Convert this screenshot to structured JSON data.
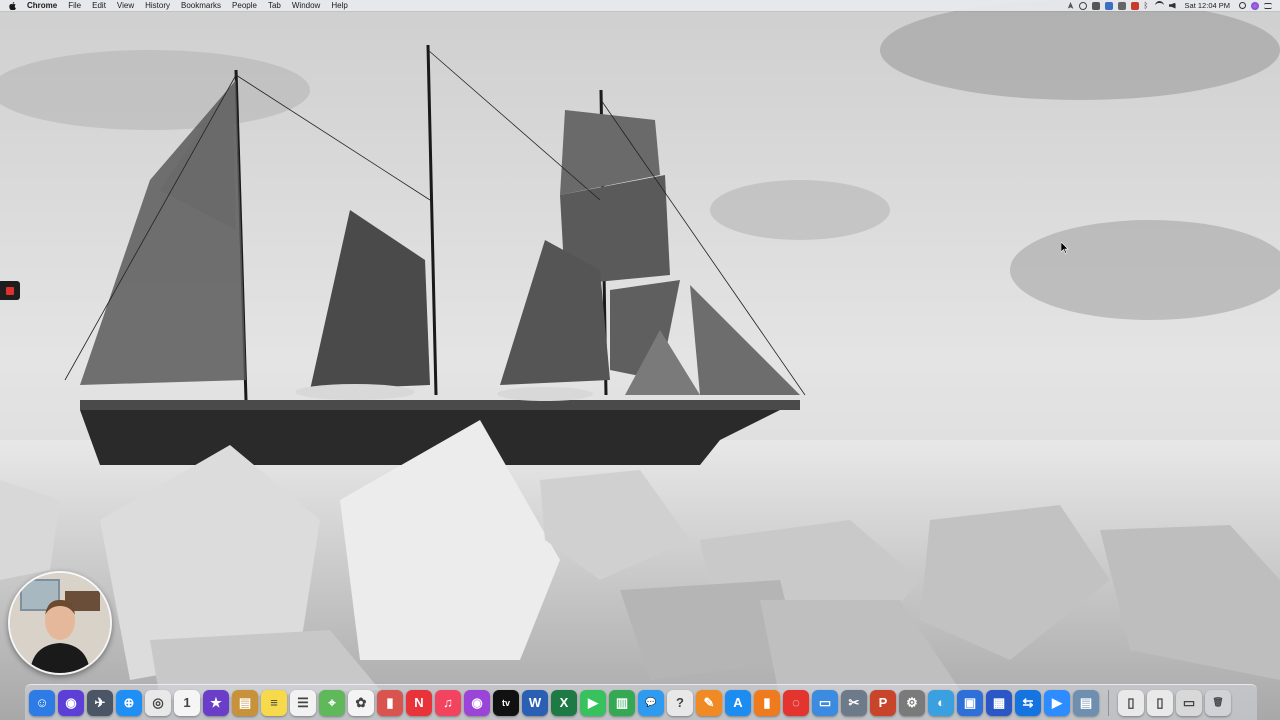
{
  "menubar": {
    "app_name": "Chrome",
    "menus": [
      "File",
      "Edit",
      "View",
      "History",
      "Bookmarks",
      "People",
      "Tab",
      "Window",
      "Help"
    ],
    "clock": "Sat 12:04 PM",
    "status_icons": [
      "location-icon",
      "screen-record-icon",
      "adobe-icon",
      "dropbox-icon",
      "screenshot-icon",
      "extension-icon",
      "bluetooth-icon",
      "wifi-icon",
      "volume-icon",
      "battery-icon",
      "spotlight-icon",
      "siri-icon",
      "notification-center-icon"
    ]
  },
  "dock": {
    "apps": [
      {
        "name": "finder-icon",
        "color": "#2d7be5",
        "glyph": "☺"
      },
      {
        "name": "siri-icon",
        "color": "#5b3fd6",
        "glyph": "◉"
      },
      {
        "name": "launchpad-icon",
        "color": "#4a5666",
        "glyph": "✈"
      },
      {
        "name": "safari-icon",
        "color": "#1f8ef5",
        "glyph": "⊕"
      },
      {
        "name": "chrome-icon",
        "color": "#e8e8e8",
        "glyph": "◎"
      },
      {
        "name": "calendar-icon",
        "color": "#f5f5f5",
        "glyph": "1"
      },
      {
        "name": "imovie-star-icon",
        "color": "#6a3ec9",
        "glyph": "★"
      },
      {
        "name": "notebook-icon",
        "color": "#c8923b",
        "glyph": "▤"
      },
      {
        "name": "notes-icon",
        "color": "#f7d94c",
        "glyph": "≡"
      },
      {
        "name": "reminders-icon",
        "color": "#f2f2f2",
        "glyph": "☰"
      },
      {
        "name": "maps-icon",
        "color": "#5fb95b",
        "glyph": "⌖"
      },
      {
        "name": "photos-icon",
        "color": "#f4f4f4",
        "glyph": "✿"
      },
      {
        "name": "file-icon",
        "color": "#d9534f",
        "glyph": "▮"
      },
      {
        "name": "news-icon",
        "color": "#e8333a",
        "glyph": "N"
      },
      {
        "name": "music-icon",
        "color": "#f2445e",
        "glyph": "♫"
      },
      {
        "name": "podcasts-icon",
        "color": "#9b45d8",
        "glyph": "◉"
      },
      {
        "name": "apple-tv-icon",
        "color": "#111111",
        "glyph": "tv"
      },
      {
        "name": "word-icon",
        "color": "#2b5fb4",
        "glyph": "W"
      },
      {
        "name": "excel-icon",
        "color": "#1e7a44",
        "glyph": "X"
      },
      {
        "name": "facetime-icon",
        "color": "#38c25d",
        "glyph": "▶"
      },
      {
        "name": "numbers-icon",
        "color": "#34a853",
        "glyph": "▥"
      },
      {
        "name": "messages-icon",
        "color": "#2f9bf0",
        "glyph": "💬"
      },
      {
        "name": "help-icon",
        "color": "#e8e8e8",
        "glyph": "?"
      },
      {
        "name": "pages-icon",
        "color": "#f08a24",
        "glyph": "✎"
      },
      {
        "name": "app-store-icon",
        "color": "#1d8cf0",
        "glyph": "A"
      },
      {
        "name": "books-icon",
        "color": "#f07a1e",
        "glyph": "▮"
      },
      {
        "name": "creative-cloud-icon",
        "color": "#e3342f",
        "glyph": "◌"
      },
      {
        "name": "keynote-icon",
        "color": "#3b8be0",
        "glyph": "▭"
      },
      {
        "name": "system-tools-icon",
        "color": "#6c7a89",
        "glyph": "✂"
      },
      {
        "name": "powerpoint-icon",
        "color": "#c8442a",
        "glyph": "P"
      },
      {
        "name": "system-preferences-icon",
        "color": "#7a7a7a",
        "glyph": "⚙"
      },
      {
        "name": "network-icon",
        "color": "#3aa0e0",
        "glyph": "◐"
      },
      {
        "name": "screen-share-icon",
        "color": "#2f6fd8",
        "glyph": "▣"
      },
      {
        "name": "directory-icon",
        "color": "#2a56c6",
        "glyph": "▦"
      },
      {
        "name": "teamviewer-icon",
        "color": "#1575e0",
        "glyph": "⇆"
      },
      {
        "name": "zoom-icon",
        "color": "#2d8cff",
        "glyph": "▶"
      },
      {
        "name": "preview-icon",
        "color": "#6f8fb0",
        "glyph": "▤"
      },
      {
        "name": "document-icon",
        "color": "#e9e9e9",
        "glyph": "▯"
      },
      {
        "name": "document-2-icon",
        "color": "#e9e9e9",
        "glyph": "▯"
      },
      {
        "name": "downloads-icon",
        "color": "#d8d8d8",
        "glyph": "▭"
      },
      {
        "name": "trash-icon",
        "color": "#cfd3d8",
        "glyph": "🗑"
      }
    ]
  }
}
